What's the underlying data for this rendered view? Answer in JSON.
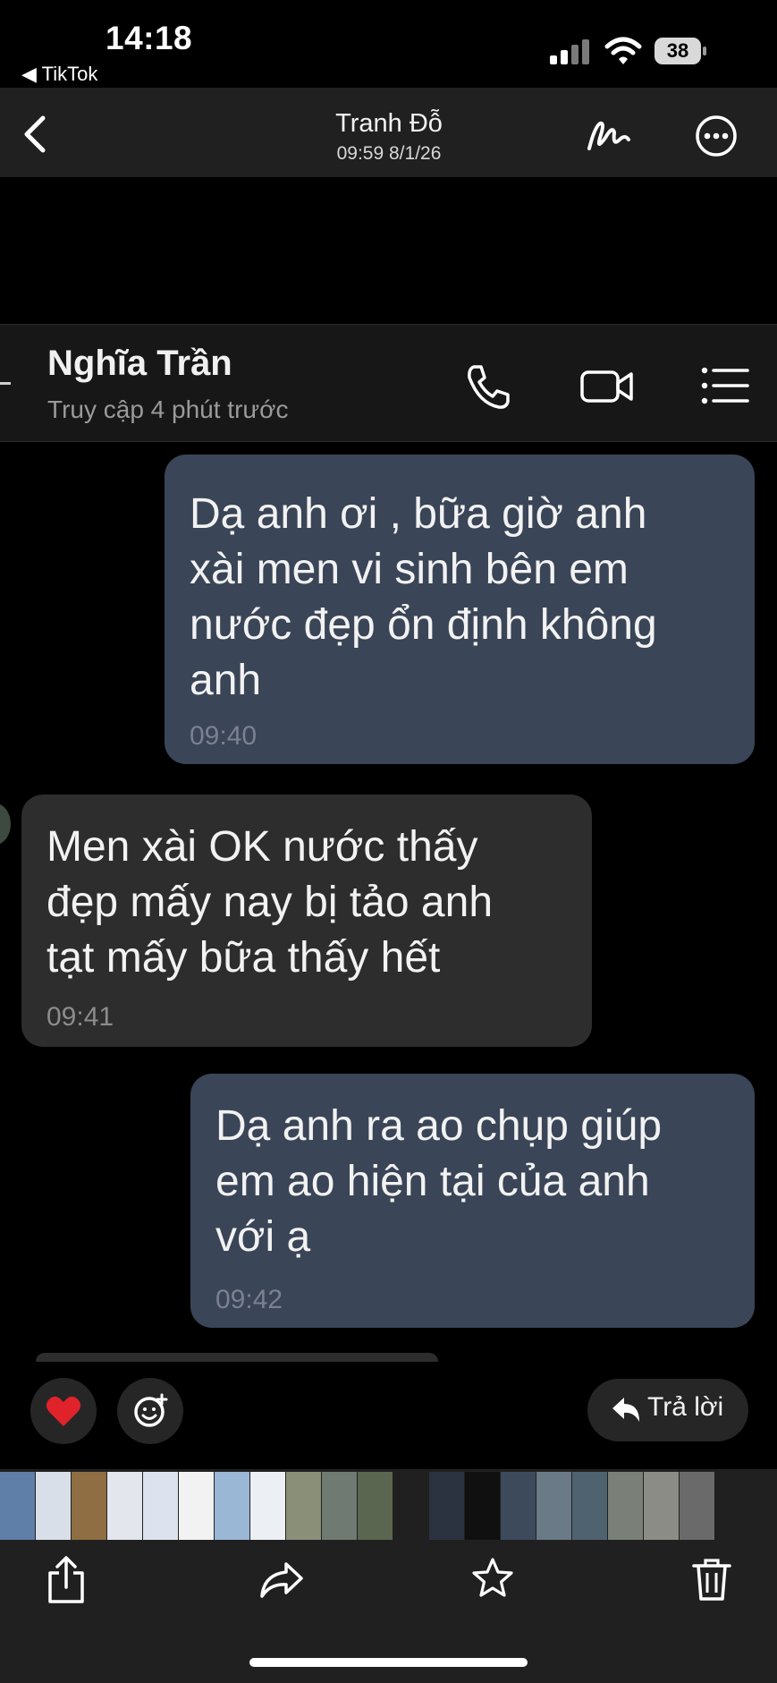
{
  "status_bar": {
    "time": "14:18",
    "back_app": "◀ TikTok",
    "battery": "38"
  },
  "viewer": {
    "title": "Tranh Đỗ",
    "date": "09:59 8/1/26"
  },
  "chat": {
    "contact_name": "Nghĩa Trần",
    "contact_status": "Truy cập 4 phút trước",
    "messages": [
      {
        "direction": "outgoing",
        "text": "Dạ anh ơi , bữa giờ anh\nxài men vi sinh bên em\nnước đẹp ổn định không\nanh",
        "time": "09:40"
      },
      {
        "direction": "incoming",
        "text": "Men xài OK nước thấy\nđẹp mấy nay bị tảo anh\ntạt mấy bữa thấy hết",
        "time": "09:41"
      },
      {
        "direction": "outgoing",
        "text": "Dạ anh ra ao chụp giúp\nem ao hiện tại của anh\nvới ạ",
        "time": "09:42"
      }
    ]
  },
  "reactions": {
    "heart": "❤️",
    "reply_label": "Trả lời"
  },
  "colors": {
    "outgoing_bubble": "#3a4557",
    "incoming_bubble": "#2d2d2d",
    "toolbar_bg": "#202020"
  },
  "thumbnails": [
    "#5f7ea8",
    "#d9dfe8",
    "#8e6e42",
    "#e3e6ec",
    "#dde3ee",
    "#f2f2f2",
    "#9ab7d6",
    "#eceff3",
    "#8a8f78",
    "#6f7a72",
    "#5a6650",
    "#1a1a1a",
    "#2b3240",
    "#101010",
    "#3c4a5c",
    "#6a7a86",
    "#4e6270",
    "#7a7f78",
    "#8c8c86",
    "#6a6a6a"
  ]
}
